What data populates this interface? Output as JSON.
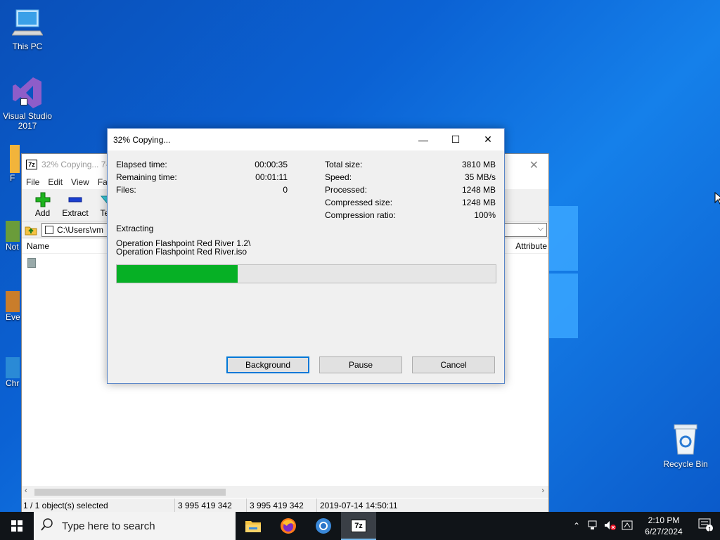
{
  "desktop": {
    "icons": [
      {
        "label": "This PC"
      },
      {
        "label": "Visual Studio 2017"
      },
      {
        "label": "Recycle Bin"
      }
    ],
    "partial_labels": [
      "F",
      "Not",
      "Eve",
      "Chr"
    ]
  },
  "file_manager": {
    "title": "32% Copying... 7-",
    "menu": [
      "File",
      "Edit",
      "View",
      "Fa"
    ],
    "toolbar": [
      "Add",
      "Extract",
      "Test"
    ],
    "path": "C:\\Users\\vm",
    "columns": {
      "name": "Name",
      "attributes": "Attribute"
    },
    "status": {
      "selected": "1 / 1 object(s) selected",
      "size": "3 995 419 342",
      "packed": "3 995 419 342",
      "modified": "2019-07-14 14:50:11"
    }
  },
  "dialog": {
    "title": "32% Copying...",
    "left_stats": [
      {
        "label": "Elapsed time:",
        "value": "00:00:35"
      },
      {
        "label": "Remaining time:",
        "value": "00:01:11"
      },
      {
        "label": "Files:",
        "value": "0"
      }
    ],
    "right_stats": [
      {
        "label": "Total size:",
        "value": "3810 MB"
      },
      {
        "label": "Speed:",
        "value": "35 MB/s"
      },
      {
        "label": "Processed:",
        "value": "1248 MB"
      },
      {
        "label": "Compressed size:",
        "value": "1248 MB"
      },
      {
        "label": "Compression ratio:",
        "value": "100%"
      }
    ],
    "operation": "Extracting",
    "file_line1": "Operation Flashpoint Red River 1.2\\",
    "file_line2": "Operation Flashpoint Red River.iso",
    "progress_fraction": 0.32,
    "buttons": {
      "background": "Background",
      "pause": "Pause",
      "cancel": "Cancel"
    }
  },
  "taskbar": {
    "search_placeholder": "Type here to search",
    "apps": [
      "file-explorer-icon",
      "firefox-icon",
      "chrome-icon",
      "7zip-icon"
    ],
    "time": "2:10 PM",
    "date": "6/27/2024",
    "notification_count": "1"
  },
  "colors": {
    "progress": "#06b025",
    "taskbar": "#101418",
    "accent": "#0078d7"
  }
}
